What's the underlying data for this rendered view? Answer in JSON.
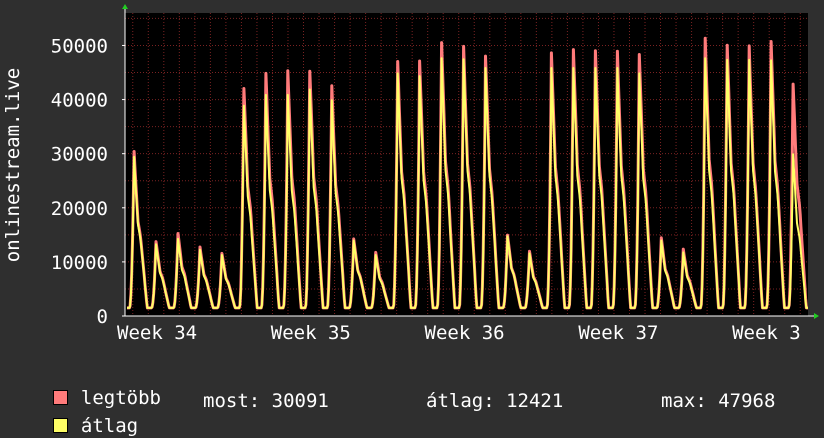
{
  "chart_data": {
    "type": "area",
    "ylabel": "onlinestream.live",
    "ylim": [
      0,
      56000
    ],
    "yticks": [
      "0",
      "10000",
      "20000",
      "30000",
      "40000",
      "50000"
    ],
    "ytick_values": [
      0,
      10000,
      20000,
      30000,
      40000,
      50000
    ],
    "xticks": [
      "Week 34",
      "Week 35",
      "Week 36",
      "Week 37",
      "Week 3"
    ],
    "grid": true,
    "series": [
      {
        "name": "legtöbb",
        "color": "#ff7b7b",
        "daily_peaks": [
          30500,
          13800,
          15300,
          12800,
          11600,
          42200,
          45000,
          45500,
          45400,
          42700,
          14300,
          11800,
          47200,
          47300,
          50700,
          50000,
          48200,
          15000,
          12000,
          48800,
          49400,
          49200,
          49100,
          48500,
          14500,
          12400,
          51500,
          50200,
          50100,
          50900,
          43000
        ]
      },
      {
        "name": "átlag",
        "color": "#ffff66",
        "daily_peaks": [
          29500,
          13300,
          14300,
          12300,
          11300,
          39000,
          41000,
          41000,
          42000,
          40000,
          14000,
          11300,
          45000,
          44500,
          47800,
          47600,
          46000,
          14800,
          11600,
          46000,
          46000,
          46000,
          46000,
          45000,
          14000,
          11800,
          47800,
          47500,
          47500,
          47400,
          30000
        ]
      }
    ]
  },
  "legend": {
    "max_label": "legtöbb",
    "avg_label": "átlag",
    "max_color": "#ff7b7b",
    "avg_color": "#ffff66"
  },
  "stats": {
    "now": "most: 30091",
    "avg": "átlag: 12421",
    "max": "max: 47968"
  }
}
